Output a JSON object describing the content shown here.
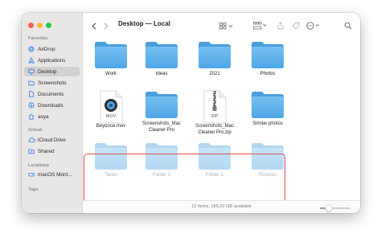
{
  "window": {
    "title": "Desktop — Local"
  },
  "sidebar": {
    "favorites_label": "Favorites",
    "favorites": [
      {
        "label": "AirDrop",
        "icon": "airdrop-icon"
      },
      {
        "label": "Applications",
        "icon": "applications-icon"
      },
      {
        "label": "Desktop",
        "icon": "desktop-icon",
        "selected": true
      },
      {
        "label": "Screenshots",
        "icon": "folder-icon"
      },
      {
        "label": "Documents",
        "icon": "document-icon"
      },
      {
        "label": "Downloads",
        "icon": "download-icon"
      },
      {
        "label": "asya",
        "icon": "home-icon"
      }
    ],
    "icloud_label": "iCloud",
    "icloud": [
      {
        "label": "iCloud Drive",
        "icon": "cloud-icon"
      },
      {
        "label": "Shared",
        "icon": "shared-folder-icon"
      }
    ],
    "locations_label": "Locations",
    "locations": [
      {
        "label": "macOS Mont...",
        "icon": "disk-icon"
      }
    ],
    "tags_label": "Tags"
  },
  "files": [
    {
      "name": "Work",
      "kind": "folder"
    },
    {
      "name": "Ideas",
      "kind": "folder"
    },
    {
      "name": "2021",
      "kind": "folder"
    },
    {
      "name": "Photos",
      "kind": "folder"
    },
    {
      "name": "Beyonce.mov",
      "kind": "movie",
      "ext": "MOV"
    },
    {
      "name": "Screenshots_Mac Cleaner Pro",
      "kind": "folder"
    },
    {
      "name": "Screenshots_Mac Cleaner Pro.zip",
      "kind": "zip",
      "ext": "ZIP"
    },
    {
      "name": "Similar photos",
      "kind": "folder"
    },
    {
      "name": "Tasks",
      "kind": "folder",
      "ghost": true
    },
    {
      "name": "Folder 2",
      "kind": "folder",
      "ghost": true
    },
    {
      "name": "Folder 1",
      "kind": "folder",
      "ghost": true
    },
    {
      "name": "Pictures",
      "kind": "folder",
      "ghost": true
    }
  ],
  "status": {
    "text": "12 items, 189,22 GB available"
  },
  "zoom_level": 0.3,
  "colors": {
    "folder_body": "#60b2ec",
    "folder_tab": "#4a9fdc",
    "selection_outline": "#e34b4b",
    "sidebar_bg": "#e9e6e6"
  }
}
